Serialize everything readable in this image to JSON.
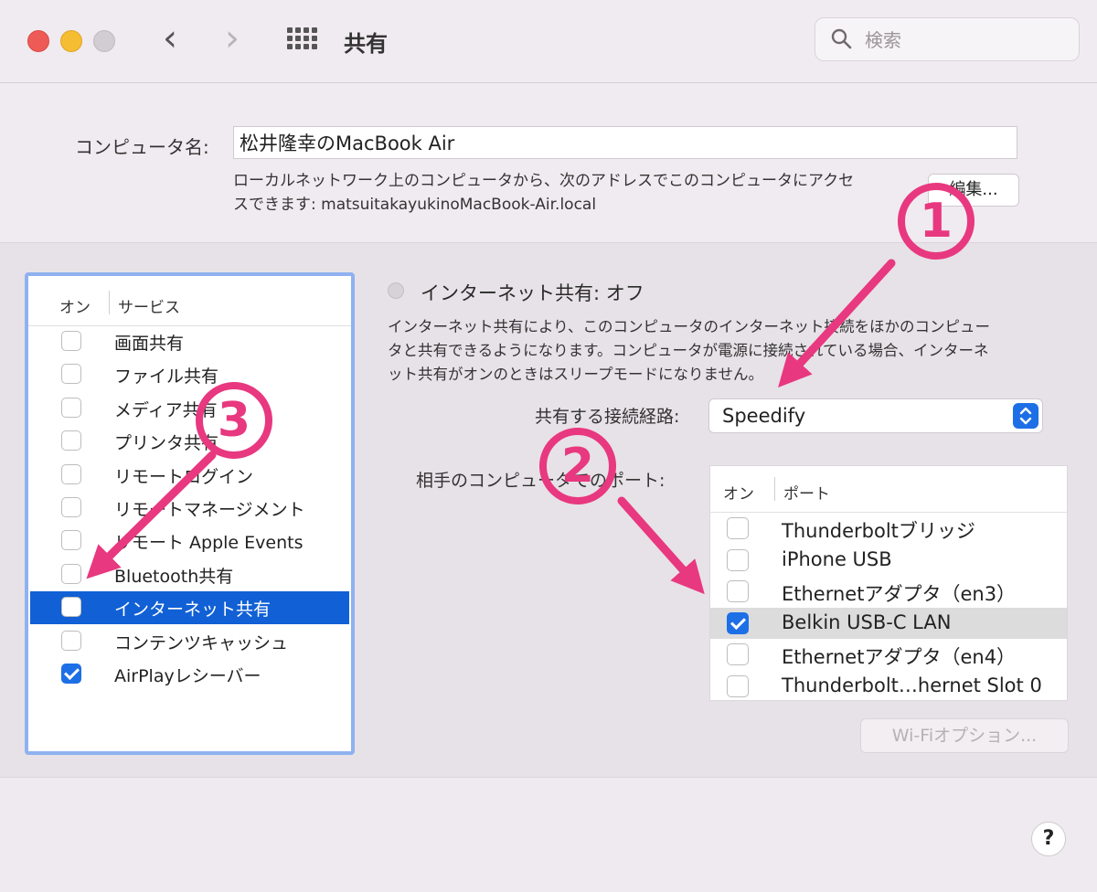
{
  "toolbar": {
    "title": "共有",
    "search_placeholder": "検索"
  },
  "computer_name": {
    "label": "コンピュータ名:",
    "value": "松井隆幸のMacBook Air",
    "address_line1": "ローカルネットワーク上のコンピュータから、次のアドレスでこのコンピュータにアクセ",
    "address_line2": "スできます: matsuitakayukinoMacBook-Air.local",
    "edit_button": "編集..."
  },
  "services": {
    "col_on": "オン",
    "col_service": "サービス",
    "items": [
      {
        "label": "画面共有",
        "checked": false,
        "selected": false
      },
      {
        "label": "ファイル共有",
        "checked": false,
        "selected": false
      },
      {
        "label": "メディア共有",
        "checked": false,
        "selected": false
      },
      {
        "label": "プリンタ共有",
        "checked": false,
        "selected": false
      },
      {
        "label": "リモートログイン",
        "checked": false,
        "selected": false
      },
      {
        "label": "リモートマネージメント",
        "checked": false,
        "selected": false
      },
      {
        "label": "リモート Apple Events",
        "checked": false,
        "selected": false
      },
      {
        "label": "Bluetooth共有",
        "checked": false,
        "selected": false
      },
      {
        "label": "インターネット共有",
        "checked": false,
        "selected": true
      },
      {
        "label": "コンテンツキャッシュ",
        "checked": false,
        "selected": false
      },
      {
        "label": "AirPlayレシーバー",
        "checked": true,
        "selected": false
      }
    ]
  },
  "internet_sharing": {
    "title": "インターネット共有: オフ",
    "desc_line1": "インターネット共有により、このコンピュータのインターネット接続をほかのコンピュー",
    "desc_line2": "タと共有できるようになります。コンピュータが電源に接続されている場合、インターネ",
    "desc_line3": "ット共有がオンのときはスリープモードになりません。",
    "route_label": "共有する接続経路:",
    "route_value": "Speedify",
    "ports_label": "相手のコンピュータでのポート:",
    "ports_col_on": "オン",
    "ports_col_port": "ポート",
    "ports": [
      {
        "label": "Thunderboltブリッジ",
        "checked": false,
        "highlight": false
      },
      {
        "label": "iPhone USB",
        "checked": false,
        "highlight": false
      },
      {
        "label": "Ethernetアダプタ（en3）",
        "checked": false,
        "highlight": false
      },
      {
        "label": "Belkin USB-C LAN",
        "checked": true,
        "highlight": true
      },
      {
        "label": "Ethernetアダプタ（en4）",
        "checked": false,
        "highlight": false
      },
      {
        "label": "Thunderbolt…hernet Slot 0",
        "checked": false,
        "highlight": false
      }
    ],
    "wifi_button": "Wi-Fiオプション..."
  },
  "help_button": "?",
  "annotations": {
    "badge1": "1",
    "badge2": "2",
    "badge3": "3",
    "color": "#e8387f"
  },
  "colors": {
    "accent": "#1d6fe6",
    "selection": "#1160d5",
    "traffic_red": "#ee5b56",
    "traffic_yellow": "#f5bd31"
  }
}
